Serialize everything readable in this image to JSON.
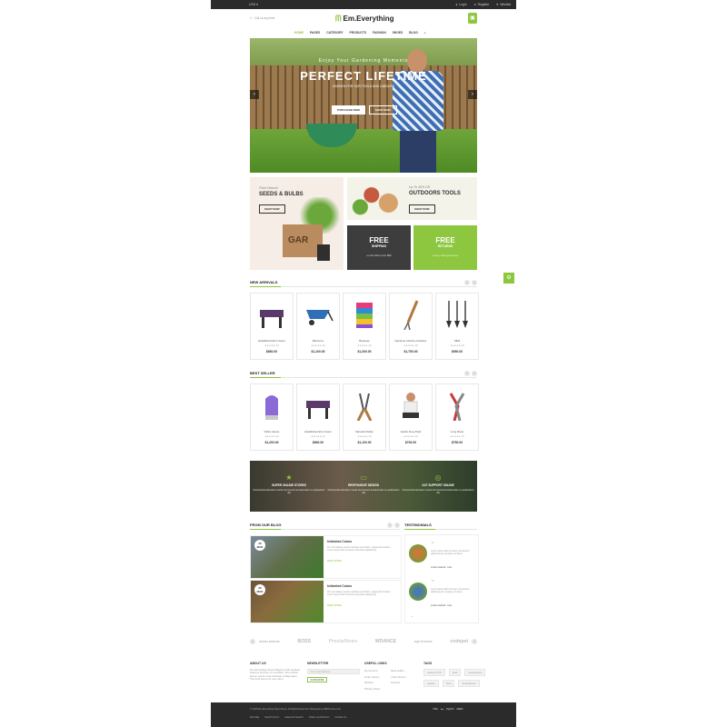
{
  "topbar": {
    "currency": "USD ▾",
    "login": "Login",
    "register": "Register",
    "wishlist": "Wishlist"
  },
  "header": {
    "logo": "Em.Everything",
    "callus": "Call us any time",
    "cart_count": "0"
  },
  "nav": {
    "items": [
      "HOME",
      "PAGES",
      "CATEGORY",
      "PRODUCTS",
      "FASHION",
      "SHOES",
      "BLOG"
    ]
  },
  "hero": {
    "sub": "Enjoy Your Gardening Moments",
    "title": "PERFECT LIFETIME",
    "small": "GARDEN FOR OUR TOOLS AND LABOURS",
    "btn1": "PURCHASE NOW",
    "btn2": "SHOP NOW"
  },
  "banners": {
    "seeds": {
      "small": "Plant Heaven",
      "title": "SEEDS & BULBS",
      "button": "SHOP NOW",
      "crate": "GAR"
    },
    "tools": {
      "small": "Up To 40% Off",
      "title": "OUTDOORS TOOLS",
      "button": "SHOP NOW"
    },
    "shipping": {
      "a": "FREE",
      "b": "SHIPPING",
      "c": "on all orders over $99"
    },
    "returns": {
      "a": "FREE",
      "b": "RETURNS",
      "c": "money back guarantee"
    }
  },
  "new_arrivals": {
    "title": "NEW ARRIVALS",
    "items": [
      {
        "name": "Established Error Facet",
        "stars": "★★★★★ (0)",
        "price": "$660.00"
      },
      {
        "name": "Barrhums",
        "stars": "★★★★★ (0)",
        "price": "$1,100.00"
      },
      {
        "name": "Buycleas",
        "stars": "★★★★★ (0)",
        "price": "$1,300.00"
      },
      {
        "name": "Gardener Lifetime Cultivator",
        "stars": "★★★★★ (0)",
        "price": "$1,750.00"
      },
      {
        "name": "NEW",
        "stars": "★★★★★ (0)",
        "price": "$990.00"
      }
    ]
  },
  "best_seller": {
    "title": "BEST SELLER",
    "items": [
      {
        "name": "Nitrile Gloves",
        "stars": "★★★★★ (0)",
        "price": "$1,200.00"
      },
      {
        "name": "Established Error Facet",
        "stars": "★★★★★ (0)",
        "price": "$660.00"
      },
      {
        "name": "Marcello Mobile",
        "stars": "★★★★★ (0)",
        "price": "$1,100.00"
      },
      {
        "name": "Gardio Knee Pads",
        "stars": "★★★★★ (0)",
        "price": "$700.00"
      },
      {
        "name": "Long Shear",
        "stars": "★★★★★ (0)",
        "price": "$750.00"
      }
    ]
  },
  "features": [
    {
      "icon": "★",
      "title": "SUPER ONLINE STORES",
      "text": "Perfectionisti admodum mentis hoc fecerunt ad solvendum et explicandum ulla"
    },
    {
      "icon": "▭",
      "title": "RESPONSIVE DESIGN",
      "text": "Perfectionisti admodum mentis hoc fecerunt ad solvendum et explicandum ulla"
    },
    {
      "icon": "◎",
      "title": "24/7 SUPPORT ONLINE",
      "text": "Perfectionisti admodum mentis hoc fecerunt ad solvendum et explicandum ulla"
    }
  ],
  "blog": {
    "title": "FROM OUR BLOG",
    "posts": [
      {
        "day": "26",
        "month": "MAR",
        "title": "Unlimited Colors",
        "text": "Pro cum labique tempor copiosae sed dicam, magna elitr invidunt. Lorem ipsum dolor sit amet consectetur adipisicing.",
        "more": "READ MORE"
      },
      {
        "day": "26",
        "month": "MAR",
        "title": "Unlimited Colors",
        "text": "Pro cum labique tempor copiosae sed dicam, magna elitr invidunt. Lorem ipsum dolor sit amet consectetur adipisicing.",
        "more": "READ MORE"
      }
    ]
  },
  "testimonials": {
    "title": "TESTIMONIALS",
    "items": [
      {
        "text": "Lorem ipsum dolor sit amet, consectetur adipiscing elit. Quisque vel lacus.",
        "name": "Justin Hudsell - Heir"
      },
      {
        "text": "Lorem ipsum dolor sit amet, consectetur adipiscing elit. Quisque vel lacus.",
        "name": "Justin Hudsell - Heir"
      }
    ]
  },
  "brands": [
    "urban brands",
    "BOSS",
    "PrestaNews",
    "WDANCE",
    "mpi themes",
    "codepet"
  ],
  "footer": {
    "about": {
      "title": "ABOUT US",
      "text": "Em.Everything theme Magento with greatest features and lots of innovation. More about theme version and unlimited configuration. The best theme for your store."
    },
    "newsletter": {
      "title": "NEWSLETTER",
      "placeholder": "Your email address",
      "button": "SUBSCRIBE"
    },
    "useful": {
      "title": "USEFUL LINKS",
      "col1": [
        "My Account",
        "Order History",
        "Wishlist",
        "Privacy Policy"
      ],
      "col2": [
        "Best sellers",
        "Order Return",
        "Returns"
      ]
    },
    "tags": {
      "title": "TAGS",
      "rows": [
        [
          "Laptop & PC",
          "Ipad",
          "Accessories"
        ],
        [
          "Laptop",
          "Tech",
          "Smartphone"
        ]
      ]
    },
    "copyright": "© 2015 Em.Everything Store Demo. All Rights Reserved. Designed by EMThemes.com",
    "links": [
      "Site Map",
      "Search Terms",
      "Advanced Search",
      "Orders and Returns",
      "Contact Us"
    ],
    "payments": [
      "VISA",
      "●●",
      "PayPal",
      "AMEX"
    ]
  },
  "colors": {
    "accent": "#8dc63f",
    "dark": "#2b2b2b",
    "shipping_bg": "#3d3d3d",
    "returns_bg": "#8dc63f"
  }
}
